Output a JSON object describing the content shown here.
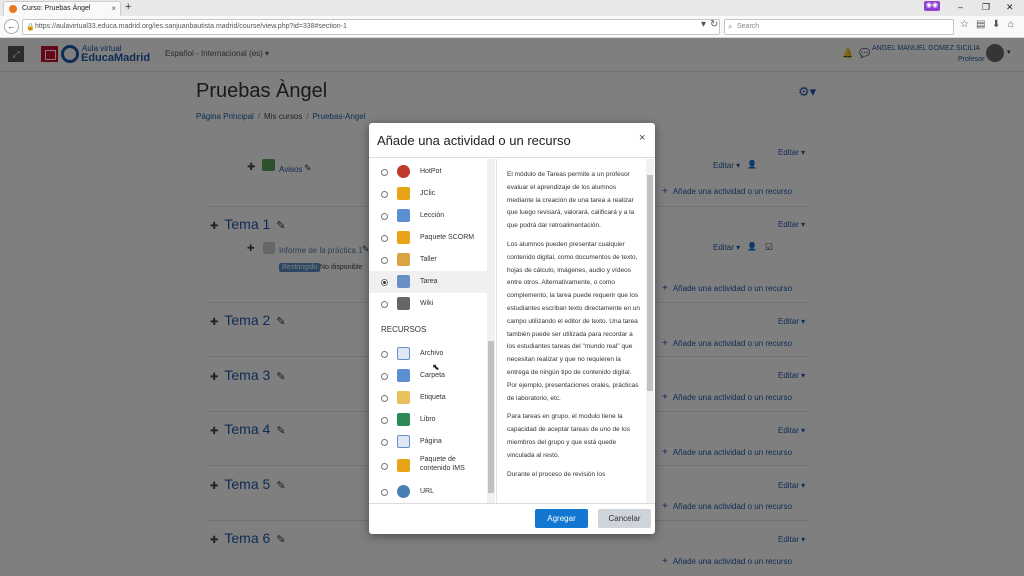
{
  "browser": {
    "tab_title": "Curso: Pruebas Àngel",
    "tab_close": "×",
    "new_tab": "+",
    "url": "https://aulavirtual33.educa.madrid.org/ies.sanjuanbautista.madrid/course/view.php?id=338#section-1",
    "search_placeholder": "Search",
    "window_min": "–",
    "window_max": "❐",
    "window_close": "✕"
  },
  "header": {
    "logo_sub": "Aula virtual",
    "logo_main": "EducaMadrid",
    "language": "Español - Internacional (es) ▾",
    "user_name": "ANGEL MANUEL GOMEZ SICILIA",
    "user_role": "Profesor"
  },
  "course": {
    "title": "Pruebas Àngel",
    "breadcrumb": [
      "Página Principal",
      "Mis cursos",
      "Pruebas-Angel"
    ],
    "edit_label": "Editar ▾",
    "add_label": "Añade una actividad o un recurso",
    "news_label": "Avisos",
    "activity_label": "Informe de la práctica 1",
    "restricted_badge": "Restringido",
    "not_available": "No disponible",
    "sections": [
      "Tema 1",
      "Tema 2",
      "Tema 3",
      "Tema 4",
      "Tema 5",
      "Tema 6"
    ]
  },
  "modal": {
    "title": "Añade una actividad o un recurso",
    "close": "×",
    "activities": [
      {
        "label": "HotPot",
        "icon": "hotpot-icon",
        "color": "#c0392b"
      },
      {
        "label": "JClic",
        "icon": "jclic-icon",
        "color": "#e8a317"
      },
      {
        "label": "Lección",
        "icon": "lesson-icon",
        "color": "#5b8fd1"
      },
      {
        "label": "Paquete SCORM",
        "icon": "scorm-icon",
        "color": "#e8a317"
      },
      {
        "label": "Taller",
        "icon": "workshop-icon",
        "color": "#d9a441"
      },
      {
        "label": "Tarea",
        "icon": "assignment-icon",
        "color": "#6a8fc7"
      },
      {
        "label": "Wiki",
        "icon": "wiki-icon",
        "color": "#666666"
      }
    ],
    "resources_heading": "RECURSOS",
    "resources": [
      {
        "label": "Archivo",
        "icon": "file-icon",
        "color": "#6a8fc7"
      },
      {
        "label": "Carpeta",
        "icon": "folder-icon",
        "color": "#5b8fd1"
      },
      {
        "label": "Etiqueta",
        "icon": "label-icon",
        "color": "#e8c15a"
      },
      {
        "label": "Libro",
        "icon": "book-icon",
        "color": "#2e8b57"
      },
      {
        "label": "Página",
        "icon": "page-icon",
        "color": "#6a8fc7"
      },
      {
        "label": "Paquete de contenido IMS",
        "icon": "ims-icon",
        "color": "#e8a317"
      },
      {
        "label": "URL",
        "icon": "url-icon",
        "color": "#4a7fb5"
      }
    ],
    "description": [
      "El módulo de Tareas permite a un profesor evaluar el aprendizaje de los alumnos mediante la creación de una tarea a realizar que luego revisará, valorará, calificará y a la que podrá dar retroalimentación.",
      "Los alumnos pueden presentar cualquier contenido digital, como documentos de texto, hojas de cálculo, imágenes, audio y vídeos entre otros. Alternativamente, o como complemento, la tarea puede requerir que los estudiantes escriban texto directamente en un campo utilizando el editor de texto. Una tarea también puede ser utilizada para recordar a los estudiantes tareas del \"mundo real\" que necesitan realizar y que no requieren la entrega de ningún tipo de contenido digital. Por ejemplo, presentaciones orales, prácticas de laboratorio, etc.",
      "Para tareas en grupo, el modulo tiene la capacidad de aceptar tareas de uno de los miembros del grupo y que está quede vinculada al resto.",
      "Durante el proceso de revisión los"
    ],
    "add_button": "Agregar",
    "cancel_button": "Cancelar"
  }
}
